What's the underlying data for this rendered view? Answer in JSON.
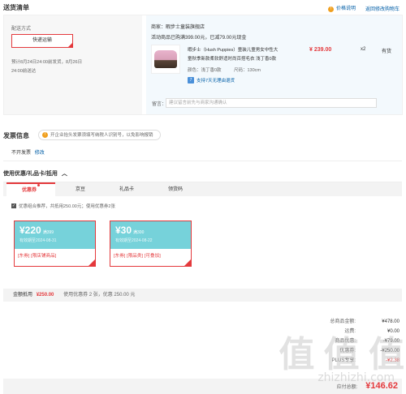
{
  "header": {
    "title": "送货清单",
    "price_note": "价格说明",
    "back_cart": "返回修改购物车"
  },
  "delivery": {
    "label": "配送方式",
    "method": "快递运输",
    "eta_line1": "预计8月24日24:00前发货，8月26日",
    "eta_line2": "24:00前送达"
  },
  "order": {
    "seller_label": "商家：",
    "seller": "暇步士童装旗舰店",
    "promo": "活动商品已购满399.00元，已减79.00元现金",
    "product_name_line1": "暇步士（Hush Puppies）童装儿童男女中性大",
    "product_name_line2": "童秋季新款柔软舒适时尚百搭毛衣 浅丁香0款",
    "price": "¥ 239.00",
    "qty": "x2",
    "stock": "有货",
    "color_label": "颜色：浅丁香0款",
    "size_label": "尺码：130cm",
    "return_badge": "7",
    "return_text": "支持7天无理由退货",
    "note_label": "留言：",
    "note_placeholder": "建议留言前先与商家沟通确认"
  },
  "invoice": {
    "title": "发票信息",
    "tip": "开企业抬头发票须填写纳税人识别号，以免影响报销",
    "status": "不开发票",
    "modify": "修改"
  },
  "coupons": {
    "title": "使用优惠/礼品卡/抵用",
    "tabs": [
      "优惠券",
      "京豆",
      "礼品卡",
      "领货码"
    ],
    "combo": "优惠组合推荐，共抵用250.00元；使用优惠券2张",
    "cards": [
      {
        "amount": "¥220",
        "cond": "满399",
        "valid": "有效期至2024-08-31",
        "tags": "[东券] [限店铺商品]"
      },
      {
        "amount": "¥30",
        "cond": "满300",
        "valid": "有效期至2024-08-22",
        "tags": "[东券] [限品类] [可叠加]"
      }
    ],
    "summary_label": "金额抵用",
    "summary_amount": "¥250.00",
    "summary_detail": "使用优惠券 2 张，优惠 250.00 元"
  },
  "totals": {
    "rows": [
      {
        "label": "总商品金额:",
        "value": "¥478.00"
      },
      {
        "label": "运费:",
        "value": "¥0.00"
      },
      {
        "label": "商品优惠:",
        "value": "-¥79.00"
      },
      {
        "label": "优惠券:",
        "value": "-¥250.00"
      },
      {
        "label": "PLUS专享:",
        "value": "-¥2.38"
      }
    ],
    "final_label": "应付总额:",
    "final_value": "¥146.62"
  },
  "watermark": {
    "main": "值 值 值",
    "sub": "zhizhizhi.com"
  }
}
